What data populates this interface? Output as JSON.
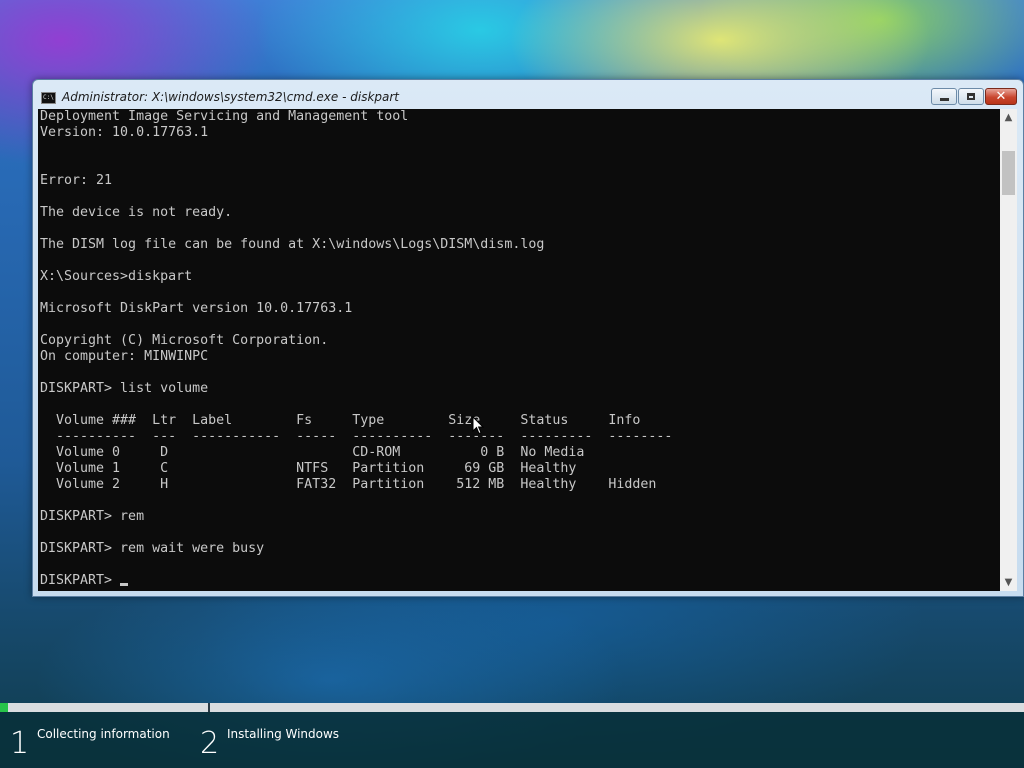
{
  "window": {
    "title": "Administrator: X:\\windows\\system32\\cmd.exe - diskpart",
    "icon": "cmd-icon",
    "buttons": {
      "minimize": "minimize",
      "maximize": "maximize",
      "close": "✕"
    }
  },
  "console": {
    "lines": [
      "Deployment Image Servicing and Management tool",
      "Version: 10.0.17763.1",
      "",
      "",
      "Error: 21",
      "",
      "The device is not ready.",
      "",
      "The DISM log file can be found at X:\\windows\\Logs\\DISM\\dism.log",
      "",
      "X:\\Sources>diskpart",
      "",
      "Microsoft DiskPart version 10.0.17763.1",
      "",
      "Copyright (C) Microsoft Corporation.",
      "On computer: MINWINPC",
      "",
      "DISKPART> list volume",
      "",
      "  Volume ###  Ltr  Label        Fs     Type        Size     Status     Info",
      "  ----------  ---  -----------  -----  ----------  -------  ---------  --------",
      "  Volume 0     D                       CD-ROM          0 B  No Media",
      "  Volume 1     C                NTFS   Partition     69 GB  Healthy",
      "  Volume 2     H                FAT32  Partition    512 MB  Healthy    Hidden",
      "",
      "DISKPART> rem",
      "",
      "DISKPART> rem wait were busy",
      ""
    ],
    "prompt": "DISKPART> "
  },
  "scrollbar": {
    "up": "▲",
    "down": "▼"
  },
  "setup": {
    "progress_fraction": 0.2,
    "steps": [
      {
        "number": "1",
        "label": "Collecting information"
      },
      {
        "number": "2",
        "label": "Installing Windows"
      }
    ],
    "colors": {
      "progress": "#27c44a"
    }
  }
}
